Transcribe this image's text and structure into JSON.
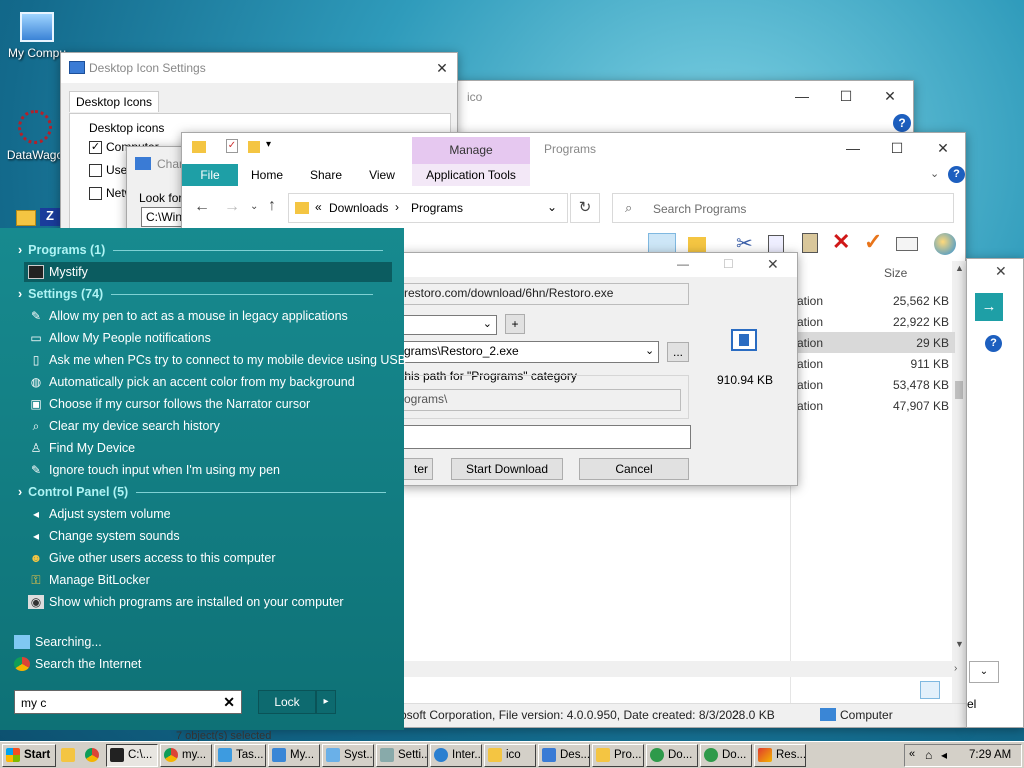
{
  "desktop": {
    "icons": [
      {
        "label": "My Compu"
      },
      {
        "label": "DataWago"
      }
    ]
  },
  "desktop_icon_settings": {
    "title": "Desktop Icon Settings",
    "tab": "Desktop Icons",
    "group": "Desktop icons",
    "checks": [
      {
        "label": "Computer",
        "checked": true
      },
      {
        "label": "User",
        "checked": false
      },
      {
        "label": "Netw",
        "checked": false
      }
    ]
  },
  "change_icon": {
    "title": "Chan",
    "look_for": "Look for",
    "path": "C:\\Wind"
  },
  "ico_window": {
    "title": "ico"
  },
  "explorer": {
    "title": "Programs",
    "context_tab": "Manage",
    "tabs": [
      "File",
      "Home",
      "Share",
      "View",
      "Application Tools"
    ],
    "breadcrumb": [
      "Downloads",
      "Programs"
    ],
    "search_placeholder": "Search Programs",
    "size_header": "Size",
    "rows": [
      {
        "type": "ation",
        "size": "25,562 KB"
      },
      {
        "type": "ation",
        "size": "22,922 KB"
      },
      {
        "type": "ation",
        "size": "29 KB"
      },
      {
        "type": "ation",
        "size": "911 KB"
      },
      {
        "type": "ation",
        "size": "53,478 KB"
      },
      {
        "type": "ation",
        "size": "47,907 KB"
      }
    ],
    "status_left": "7 object(s) selected",
    "status_mid": "osoft Corporation, File version: 4.0.0.950, Date created: 8/3/202",
    "status_size": "28.0 KB",
    "status_location": "Computer",
    "status_extra": "el"
  },
  "download_dialog": {
    "url": "restoro.com/download/6hn/Restoro.exe",
    "save_path": "grams\\Restoro_2.exe",
    "remember_label": "this path for \"Programs\" category",
    "category_path": "ograms\\",
    "file_size": "910.94 KB",
    "buttons": {
      "later": "ter",
      "start": "Start Download",
      "cancel": "Cancel"
    }
  },
  "start_menu": {
    "groups": [
      {
        "label": "Programs (1)",
        "items": [
          {
            "label": "Mystify",
            "icon": "mystify-icon"
          }
        ]
      },
      {
        "label": "Settings (74)",
        "items": [
          {
            "label": "Allow my pen to act as a mouse in legacy applications",
            "icon": "pen-icon"
          },
          {
            "label": "Allow My People notifications",
            "icon": "taskbar-icon"
          },
          {
            "label": "Ask me when PCs try to connect to my mobile device using USB",
            "icon": "phone-icon"
          },
          {
            "label": "Automatically pick an accent color from my background",
            "icon": "palette-icon"
          },
          {
            "label": "Choose if my cursor follows the Narrator cursor",
            "icon": "narrator-icon"
          },
          {
            "label": "Clear my device search history",
            "icon": "search-history-icon"
          },
          {
            "label": "Find My Device",
            "icon": "person-icon"
          },
          {
            "label": "Ignore touch input when I'm using my pen",
            "icon": "pen-icon"
          }
        ]
      },
      {
        "label": "Control Panel (5)",
        "items": [
          {
            "label": "Adjust system volume",
            "icon": "speaker-icon"
          },
          {
            "label": "Change system sounds",
            "icon": "speaker-icon"
          },
          {
            "label": "Give other users access to this computer",
            "icon": "users-icon"
          },
          {
            "label": "Manage BitLocker",
            "icon": "bitlocker-icon"
          },
          {
            "label": "Show which programs are installed on your computer",
            "icon": "programs-icon"
          }
        ]
      }
    ],
    "searching": "Searching...",
    "search_internet": "Search the Internet",
    "search_value": "my c",
    "lock_label": "Lock"
  },
  "taskbar": {
    "start_label": "Start",
    "buttons": [
      "C:\\...",
      "my...",
      "Tas...",
      "My...",
      "Syst...",
      "Setti...",
      "Inter...",
      "ico",
      "Des...",
      "Pro...",
      "Do...",
      "Do...",
      "Res..."
    ],
    "clock": "7:29 AM"
  },
  "colors": {
    "start_menu_bg": "#128087",
    "start_menu_group": "#aef3f4",
    "ribbon_manage": "#e6c8f0",
    "file_tab": "#1e9fa6"
  }
}
